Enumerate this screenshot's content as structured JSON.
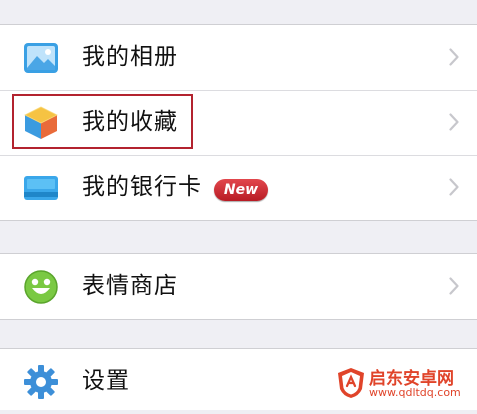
{
  "colors": {
    "page_background": "#efeff4",
    "row_background": "#ffffff",
    "label_text": "#111111",
    "chevron": "#c7c7cc",
    "highlight_border": "#b3232f",
    "badge_red": "#c52730",
    "watermark": "#e0442a"
  },
  "menu": {
    "group1": [
      {
        "label": "我的相册",
        "icon": "photo-album-icon"
      },
      {
        "label": "我的收藏",
        "icon": "favorites-cube-icon",
        "highlighted": true
      },
      {
        "label": "我的银行卡",
        "icon": "bank-card-icon",
        "badge": "New"
      }
    ],
    "group2": [
      {
        "label": "表情商店",
        "icon": "smiley-face-icon"
      }
    ],
    "group3": [
      {
        "label": "设置",
        "icon": "gear-icon"
      }
    ]
  },
  "watermark": {
    "title": "启东安卓网",
    "url": "www.qdltdq.com"
  }
}
